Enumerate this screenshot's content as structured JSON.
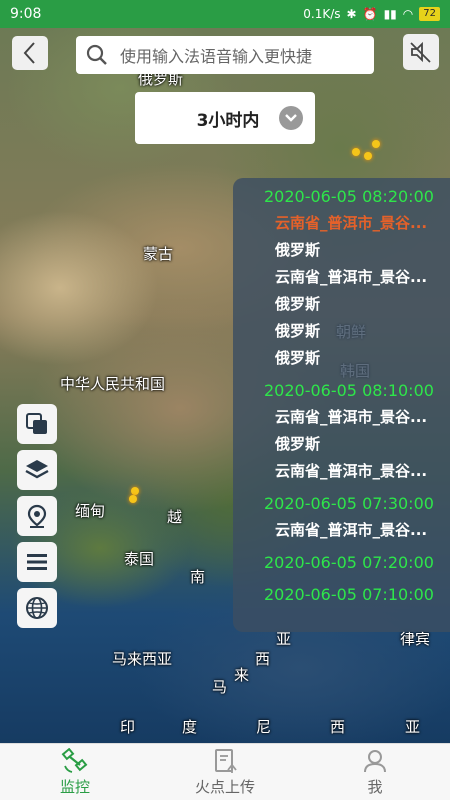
{
  "status": {
    "time": "9:08",
    "network": "0.1K/s",
    "battery": "72"
  },
  "search": {
    "placeholder": "使用输入法语音输入更快捷"
  },
  "filter": {
    "selected": "3小时内"
  },
  "map_labels": [
    "俄罗斯",
    "蒙古",
    "中华人民共和国",
    "朝鲜",
    "韩国",
    "缅甸",
    "越",
    "泰国",
    "南",
    "马来西亚",
    "西",
    "马",
    "来",
    "亚",
    "印",
    "度",
    "尼",
    "西",
    "亚",
    "律宾"
  ],
  "fire_list": [
    {
      "time": "2020-06-05 08:20:00",
      "items": [
        "云南省_普洱市_景谷...",
        "俄罗斯",
        "云南省_普洱市_景谷...",
        "俄罗斯",
        "俄罗斯",
        "俄罗斯"
      ]
    },
    {
      "time": "2020-06-05 08:10:00",
      "items": [
        "云南省_普洱市_景谷...",
        "俄罗斯",
        "云南省_普洱市_景谷..."
      ]
    },
    {
      "time": "2020-06-05 07:30:00",
      "items": [
        "云南省_普洱市_景谷..."
      ]
    },
    {
      "time": "2020-06-05 07:20:00",
      "items": []
    },
    {
      "time": "2020-06-05 07:10:00",
      "items": []
    }
  ],
  "tools": [
    "layers-copy-icon",
    "layers-icon",
    "location-pin-icon",
    "menu-list-icon",
    "globe-icon"
  ],
  "nav": [
    {
      "label": "监控",
      "icon": "satellite-icon",
      "active": true
    },
    {
      "label": "火点上传",
      "icon": "upload-doc-icon",
      "active": false
    },
    {
      "label": "我",
      "icon": "user-icon",
      "active": false
    }
  ],
  "colors": {
    "accent": "#2a9d45",
    "list_time": "#2ee64a",
    "list_active": "#e4612a"
  }
}
